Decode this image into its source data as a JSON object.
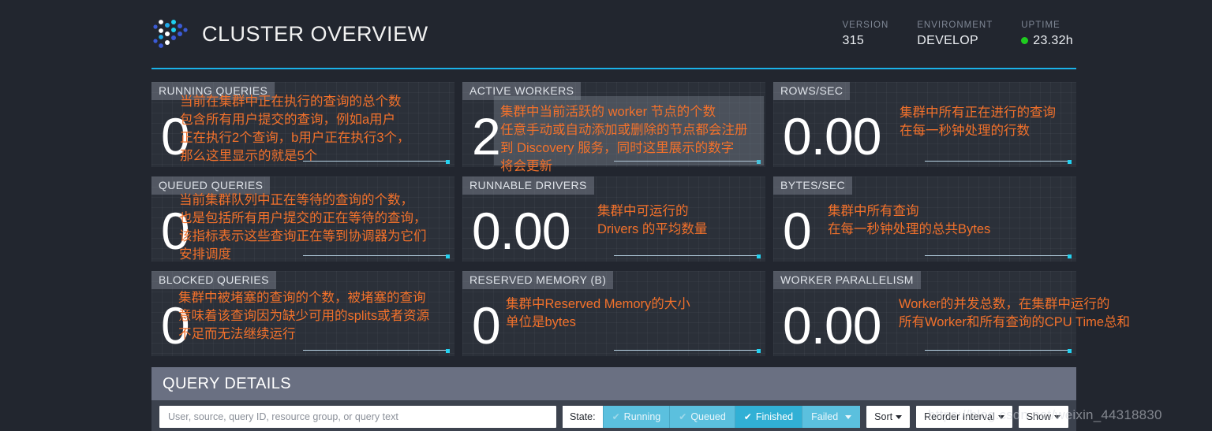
{
  "header": {
    "title": "CLUSTER OVERVIEW",
    "logo_icon": "presto-dots-logo-icon",
    "meta": [
      {
        "label": "VERSION",
        "value": "315",
        "has_dot": false
      },
      {
        "label": "ENVIRONMENT",
        "value": "DEVELOP",
        "has_dot": false
      },
      {
        "label": "UPTIME",
        "value": "23.32h",
        "has_dot": true
      }
    ],
    "accent_color": "#1ab2e8",
    "status_dot_color": "#1fcc1f"
  },
  "stats": [
    {
      "label": "RUNNING QUERIES",
      "value": "0"
    },
    {
      "label": "ACTIVE WORKERS",
      "value": "2"
    },
    {
      "label": "ROWS/SEC",
      "value": "0.00"
    },
    {
      "label": "QUEUED QUERIES",
      "value": "0"
    },
    {
      "label": "RUNNABLE DRIVERS",
      "value": "0.00"
    },
    {
      "label": "BYTES/SEC",
      "value": "0"
    },
    {
      "label": "BLOCKED QUERIES",
      "value": "0"
    },
    {
      "label": "RESERVED MEMORY (B)",
      "value": "0"
    },
    {
      "label": "WORKER PARALLELISM",
      "value": "0.00"
    }
  ],
  "annotations": {
    "color": "#f2712b",
    "running_queries": "当前在集群中正在执行的查询的总个数\n包含所有用户提交的查询，例如a用户\n正在执行2个查询，b用户正在执行3个，\n那么这里显示的就是5个",
    "active_workers": "集群中当前活跃的 worker 节点的个数\n任意手动或自动添加或删除的节点都会注册\n到 Discovery 服务，同时这里展示的数字\n将会更新",
    "rows_sec": "集群中所有正在进行的查询\n在每一秒钟处理的行数",
    "queued_queries": "当前集群队列中正在等待的查询的个数，\n也是包括所有用户提交的正在等待的查询，\n该指标表示这些查询正在等到协调器为它们\n安排调度",
    "runnable_drivers": "集群中可运行的\nDrivers 的平均数量",
    "bytes_sec": "集群中所有查询\n在每一秒钟处理的总共Bytes",
    "blocked_queries": "集群中被堵塞的查询的个数，被堵塞的查询\n意味着该查询因为缺少可用的splits或者资源\n不足而无法继续运行",
    "reserved_memory": "集群中Reserved Memory的大小\n单位是bytes",
    "worker_parallelism": "Worker的并发总数，在集群中运行的\n所有Worker和所有查询的CPU Time总和"
  },
  "query_details": {
    "title": "QUERY DETAILS",
    "search_placeholder": "User, source, query ID, resource group, or query text",
    "search_value": "",
    "state_label": "State:",
    "state_filters": [
      {
        "label": "Running",
        "active": false,
        "check_icon": "check-icon",
        "has_caret": false
      },
      {
        "label": "Queued",
        "active": false,
        "check_icon": "check-icon",
        "has_caret": false
      },
      {
        "label": "Finished",
        "active": true,
        "check_icon": "check-icon",
        "has_caret": false
      },
      {
        "label": "Failed",
        "active": false,
        "check_icon": "",
        "has_caret": true
      }
    ],
    "dropdowns": [
      {
        "label": "Sort"
      },
      {
        "label": "Reorder Interval"
      },
      {
        "label": "Show"
      }
    ]
  },
  "watermark": "https://blog.csdn.net/weixin_44318830"
}
